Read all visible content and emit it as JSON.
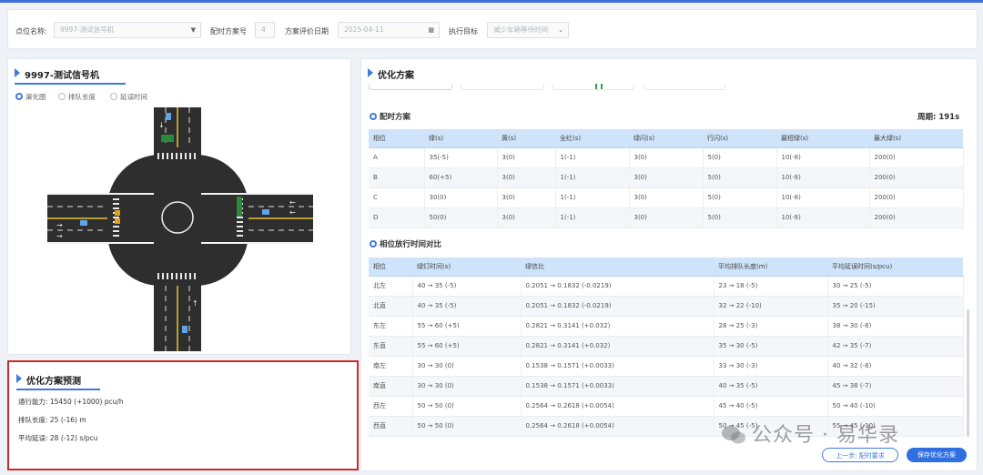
{
  "filter": {
    "point_label": "点位名称:",
    "point_value": "9997-测试信号机",
    "plan_no_label": "配时方案号",
    "plan_no_value": "4",
    "eval_date_label": "方案评价日期",
    "eval_date_value": "2025-04-11",
    "target_label": "执行目标",
    "target_value": "减少车辆等待时间"
  },
  "left": {
    "title": "9997-测试信号机",
    "radios": [
      "渠化图",
      "排队长度",
      "延误时间"
    ],
    "selected_radio": 0
  },
  "prediction": {
    "title": "优化方案预测",
    "capacity": "通行能力: 15450 (+1000) pcu/h",
    "queue": "排队长度: 25 (-16) m",
    "delay": "平均延误: 28 (-12) s/pcu"
  },
  "right": {
    "title": "优化方案",
    "timing_section": "配时方案",
    "cycle": "周期: 191s",
    "timing_headers": [
      "相位",
      "绿(s)",
      "黄(s)",
      "全红(s)",
      "绿闪(s)",
      "行闪(s)",
      "最短绿(s)",
      "最大绿(s)"
    ],
    "timing_rows": [
      [
        "A",
        "35(-5)",
        "3(0)",
        "1(-1)",
        "3(0)",
        "5(0)",
        "10(-8)",
        "200(0)"
      ],
      [
        "B",
        "60(+5)",
        "3(0)",
        "1(-1)",
        "3(0)",
        "5(0)",
        "10(-8)",
        "200(0)"
      ],
      [
        "C",
        "30(0)",
        "3(0)",
        "1(-1)",
        "3(0)",
        "5(0)",
        "10(-8)",
        "200(0)"
      ],
      [
        "D",
        "50(0)",
        "3(0)",
        "1(-1)",
        "3(0)",
        "5(0)",
        "10(-8)",
        "200(0)"
      ]
    ],
    "compare_section": "相位放行时间对比",
    "compare_headers": [
      "相位",
      "绿灯时间(s)",
      "绿信比",
      "平均排队长度(m)",
      "平均延误时间(s/pcu)"
    ],
    "compare_rows": [
      [
        "北左",
        "40 → 35 (-5)",
        "0.2051 → 0.1832 (-0.0219)",
        "23 → 18 (-5)",
        "30 → 25 (-5)"
      ],
      [
        "北直",
        "40 → 35 (-5)",
        "0.2051 → 0.1832 (-0.0219)",
        "32 → 22 (-10)",
        "35 → 20 (-15)"
      ],
      [
        "东左",
        "55 → 60 (+5)",
        "0.2821 → 0.3141 (+0.032)",
        "28 → 25 (-3)",
        "38 → 30 (-8)"
      ],
      [
        "东直",
        "55 → 60 (+5)",
        "0.2821 → 0.3141 (+0.032)",
        "35 → 30 (-5)",
        "42 → 35 (-7)"
      ],
      [
        "南左",
        "30 → 30 (0)",
        "0.1538 → 0.1571 (+0.0033)",
        "33 → 30 (-3)",
        "40 → 32 (-8)"
      ],
      [
        "南直",
        "30 → 30 (0)",
        "0.1538 → 0.1571 (+0.0033)",
        "40 → 35 (-5)",
        "45 → 38 (-7)"
      ],
      [
        "西左",
        "50 → 50 (0)",
        "0.2564 → 0.2618 (+0.0054)",
        "45 → 40 (-5)",
        "50 → 40 (-10)"
      ],
      [
        "西直",
        "50 → 50 (0)",
        "0.2564 → 0.2618 (+0.0054)",
        "50 → 45 (-5)",
        "55 → 45 (-10)"
      ]
    ],
    "prev_button": "上一步: 配时要求",
    "save_button": "保存优化方案"
  },
  "watermark": "公众号 · 易华录",
  "colors": {
    "accent": "#3d7bd8",
    "header": "#cfe3fb",
    "highlight_border": "#cc2a2a"
  }
}
